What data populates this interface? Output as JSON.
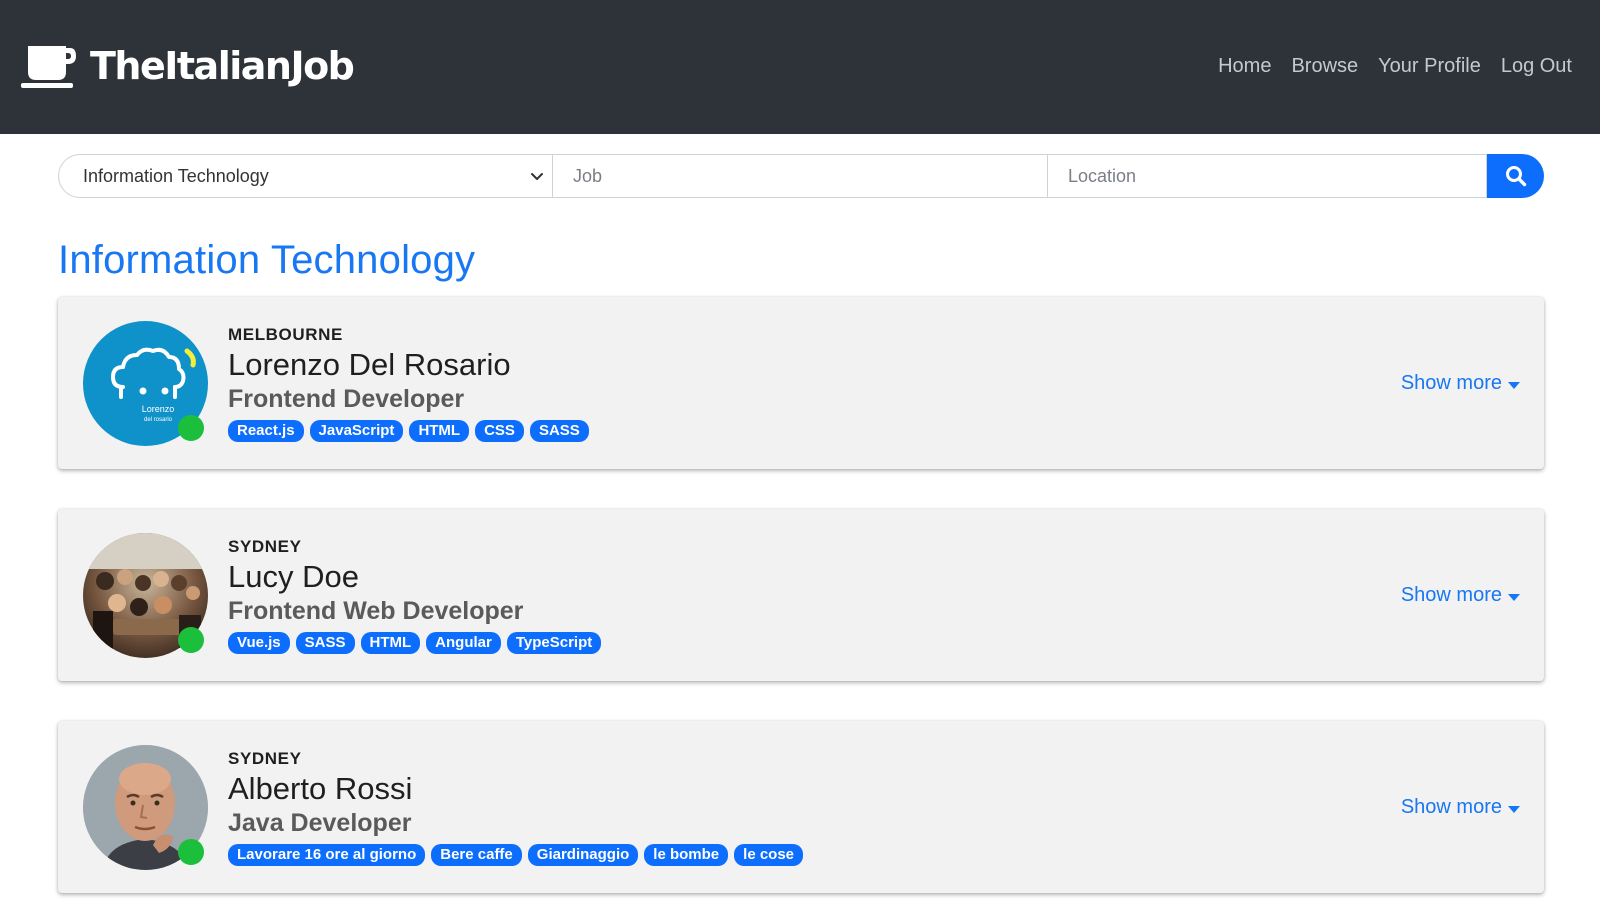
{
  "header": {
    "brand": "TheItalianJob",
    "brand_icon": "coffee-cup-icon",
    "nav": [
      "Home",
      "Browse",
      "Your Profile",
      "Log Out"
    ]
  },
  "search": {
    "category_value": "Information Technology",
    "job_placeholder": "Job",
    "location_placeholder": "Location",
    "button_icon": "search-icon"
  },
  "heading": "Information Technology",
  "colors": {
    "accent": "#1877f2",
    "button": "#0d6efd",
    "online": "#1cbf3b",
    "header_bg": "#2e333a"
  },
  "candidates": [
    {
      "city": "MELBOURNE",
      "name": "Lorenzo Del Rosario",
      "role": "Frontend Developer",
      "tags": [
        "React.js",
        "JavaScript",
        "HTML",
        "CSS",
        "SASS"
      ],
      "avatar_text": [
        "Lorenzo",
        "del rosario"
      ],
      "show_more": "Show more"
    },
    {
      "city": "SYDNEY",
      "name": "Lucy Doe",
      "role": "Frontend Web Developer",
      "tags": [
        "Vue.js",
        "SASS",
        "HTML",
        "Angular",
        "TypeScript"
      ],
      "show_more": "Show more"
    },
    {
      "city": "SYDNEY",
      "name": "Alberto Rossi",
      "role": "Java Developer",
      "tags": [
        "Lavorare 16 ore al giorno",
        "Bere caffe",
        "Giardinaggio",
        "le bombe",
        "le cose"
      ],
      "show_more": "Show more"
    }
  ]
}
